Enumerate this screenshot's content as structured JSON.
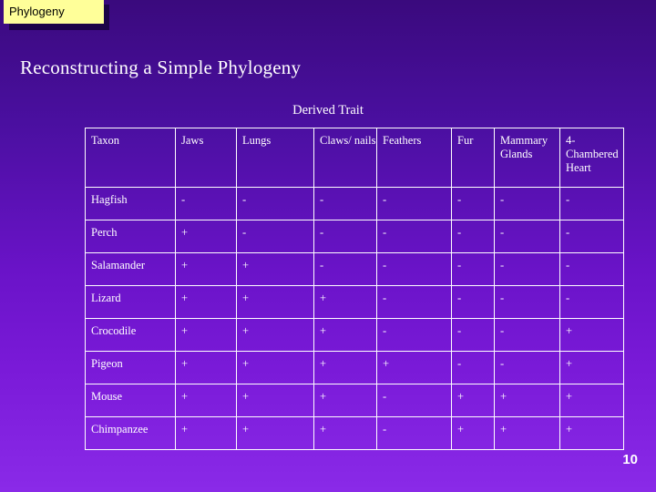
{
  "tab": {
    "label": "Phylogeny"
  },
  "slide": {
    "title": "Reconstructing a Simple Phylogeny",
    "table_caption": "Derived Trait",
    "page_number": "10"
  },
  "table": {
    "headers": [
      "Taxon",
      "Jaws",
      "Lungs",
      "Claws/ nails",
      "Feathers",
      "Fur",
      "Mammary Glands",
      "4-Chambered Heart"
    ],
    "rows": [
      {
        "taxon": "Hagfish",
        "values": [
          "-",
          "-",
          "-",
          "-",
          "-",
          "-",
          "-"
        ]
      },
      {
        "taxon": "Perch",
        "values": [
          "+",
          "-",
          "-",
          "-",
          "-",
          "-",
          "-"
        ]
      },
      {
        "taxon": "Salamander",
        "values": [
          "+",
          "+",
          "-",
          "-",
          "-",
          "-",
          "-"
        ]
      },
      {
        "taxon": "Lizard",
        "values": [
          "+",
          "+",
          "+",
          "-",
          "-",
          "-",
          "-"
        ]
      },
      {
        "taxon": "Crocodile",
        "values": [
          "+",
          "+",
          "+",
          "-",
          "-",
          "-",
          "+"
        ]
      },
      {
        "taxon": "Pigeon",
        "values": [
          "+",
          "+",
          "+",
          "+",
          "-",
          "-",
          "+"
        ]
      },
      {
        "taxon": "Mouse",
        "values": [
          "+",
          "+",
          "+",
          "-",
          "+",
          "+",
          "+"
        ]
      },
      {
        "taxon": "Chimpanzee",
        "values": [
          "+",
          "+",
          "+",
          "-",
          "+",
          "+",
          "+"
        ]
      }
    ]
  },
  "colors": {
    "background_top": "#3a0a7d",
    "background_bottom": "#8a2ae8",
    "tab_fill": "#ffff99",
    "text": "#ffffff"
  }
}
